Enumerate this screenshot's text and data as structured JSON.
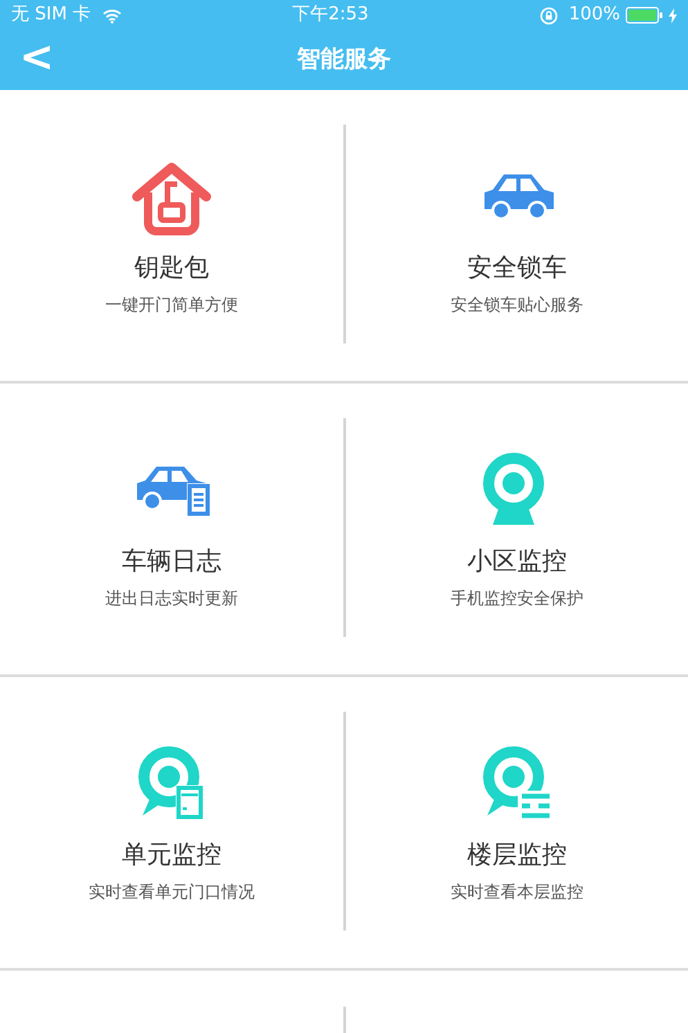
{
  "status_bar": {
    "carrier": "无 SIM 卡",
    "time": "下午2:53",
    "battery": "100%",
    "charging": true
  },
  "header": {
    "back": "<",
    "title": "智能服务"
  },
  "services": [
    {
      "kind": "key-house",
      "title": "钥匙包",
      "subtitle": "一键开门简单方便"
    },
    {
      "kind": "car",
      "title": "安全锁车",
      "subtitle": "安全锁车贴心服务"
    },
    {
      "kind": "car-log",
      "title": "车辆日志",
      "subtitle": "进出日志实时更新"
    },
    {
      "kind": "camera",
      "title": "小区监控",
      "subtitle": "手机监控安全保护"
    },
    {
      "kind": "camera-door",
      "title": "单元监控",
      "subtitle": "实时查看单元门口情况"
    },
    {
      "kind": "camera-floor",
      "title": "楼层监控",
      "subtitle": "实时查看本层监控"
    }
  ]
}
